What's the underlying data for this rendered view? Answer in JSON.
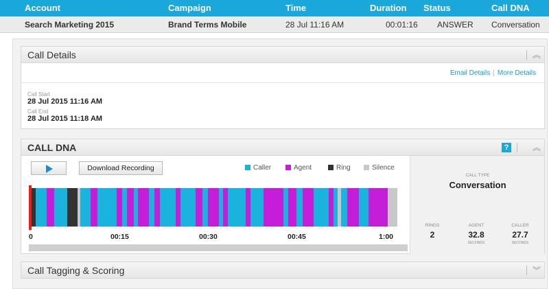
{
  "table": {
    "headers": [
      "Account",
      "Campaign",
      "Time",
      "Duration",
      "Status",
      "Call DNA"
    ],
    "row": {
      "account": "Search Marketing 2015",
      "campaign": "Brand Terms Mobile",
      "time": "28 Jul 11:16 AM",
      "duration": "00:01:16",
      "status": "ANSWER",
      "call_dna": "Conversation"
    }
  },
  "call_details": {
    "title": "Call Details",
    "email_link": "Email Details",
    "more_link": "More Details",
    "call_start_label": "Call Start",
    "call_start_value": "28 Jul 2015 11:16 AM",
    "call_end_label": "Call End",
    "call_end_value": "28 Jul 2015 11:18 AM",
    "collapse_icon": "chevron-up-icon"
  },
  "call_dna": {
    "title": "CALL DNA",
    "help_label": "?",
    "play_icon": "play-icon",
    "download_label": "Download Recording",
    "legend": [
      {
        "label": "Caller",
        "color": "#19b3dd"
      },
      {
        "label": "Agent",
        "color": "#c51ed8"
      },
      {
        "label": "Ring",
        "color": "#333333"
      },
      {
        "label": "Silence",
        "color": "#c8c8c8"
      }
    ],
    "timeline_axis": [
      "0",
      "00:15",
      "00:30",
      "00:45",
      "1:00"
    ],
    "call_type_label": "CALL TYPE",
    "call_type_value": "Conversation",
    "stats": [
      {
        "label": "RINGS",
        "value": "2",
        "unit": ""
      },
      {
        "label": "AGENT",
        "value": "32.8",
        "unit": "SECONDS"
      },
      {
        "label": "CALLER",
        "value": "27.7",
        "unit": "SECONDS"
      }
    ],
    "timeline_segments": [
      {
        "type": "Ring",
        "start": 0,
        "end": 1.1
      },
      {
        "type": "Caller",
        "start": 1.1,
        "end": 3.0
      },
      {
        "type": "Agent",
        "start": 3.0,
        "end": 4.2
      },
      {
        "type": "Caller",
        "start": 4.2,
        "end": 6.3
      },
      {
        "type": "Ring",
        "start": 6.3,
        "end": 8.0
      },
      {
        "type": "Silence",
        "start": 8.0,
        "end": 8.5
      },
      {
        "type": "Caller",
        "start": 8.5,
        "end": 10.2
      },
      {
        "type": "Agent",
        "start": 10.2,
        "end": 11.3
      },
      {
        "type": "Caller",
        "start": 11.3,
        "end": 14.5
      },
      {
        "type": "Agent",
        "start": 14.5,
        "end": 15.4
      },
      {
        "type": "Caller",
        "start": 15.4,
        "end": 16.2
      },
      {
        "type": "Agent",
        "start": 16.2,
        "end": 17.3
      },
      {
        "type": "Caller",
        "start": 17.3,
        "end": 18.0
      },
      {
        "type": "Agent",
        "start": 18.0,
        "end": 19.8
      },
      {
        "type": "Caller",
        "start": 19.8,
        "end": 20.7
      },
      {
        "type": "Agent",
        "start": 20.7,
        "end": 21.6
      },
      {
        "type": "Caller",
        "start": 21.6,
        "end": 24.2
      },
      {
        "type": "Agent",
        "start": 24.2,
        "end": 25.0
      },
      {
        "type": "Caller",
        "start": 25.0,
        "end": 27.5
      },
      {
        "type": "Agent",
        "start": 27.5,
        "end": 28.6
      },
      {
        "type": "Caller",
        "start": 28.6,
        "end": 29.6
      },
      {
        "type": "Agent",
        "start": 29.6,
        "end": 31.4
      },
      {
        "type": "Caller",
        "start": 31.4,
        "end": 32.0
      },
      {
        "type": "Agent",
        "start": 32.0,
        "end": 32.8
      },
      {
        "type": "Caller",
        "start": 32.8,
        "end": 35.8
      },
      {
        "type": "Agent",
        "start": 35.8,
        "end": 36.6
      },
      {
        "type": "Caller",
        "start": 36.6,
        "end": 38.7
      },
      {
        "type": "Agent",
        "start": 38.7,
        "end": 42.0
      },
      {
        "type": "Caller",
        "start": 42.0,
        "end": 42.8
      },
      {
        "type": "Agent",
        "start": 42.8,
        "end": 44.2
      },
      {
        "type": "Caller",
        "start": 44.2,
        "end": 45.2
      },
      {
        "type": "Agent",
        "start": 45.2,
        "end": 47.0
      },
      {
        "type": "Caller",
        "start": 47.0,
        "end": 49.5
      },
      {
        "type": "Agent",
        "start": 49.5,
        "end": 50.3
      },
      {
        "type": "Caller",
        "start": 50.3,
        "end": 51.0
      },
      {
        "type": "Silence",
        "start": 51.0,
        "end": 51.5
      },
      {
        "type": "Caller",
        "start": 51.5,
        "end": 52.5
      },
      {
        "type": "Agent",
        "start": 52.5,
        "end": 54.5
      },
      {
        "type": "Caller",
        "start": 54.5,
        "end": 56.0
      },
      {
        "type": "Agent",
        "start": 56.0,
        "end": 59.2
      },
      {
        "type": "Silence",
        "start": 59.2,
        "end": 60.8
      }
    ],
    "collapse_icon": "chevron-up-icon"
  },
  "tagging": {
    "title": "Call Tagging & Scoring",
    "expand_icon": "chevron-down-icon"
  }
}
